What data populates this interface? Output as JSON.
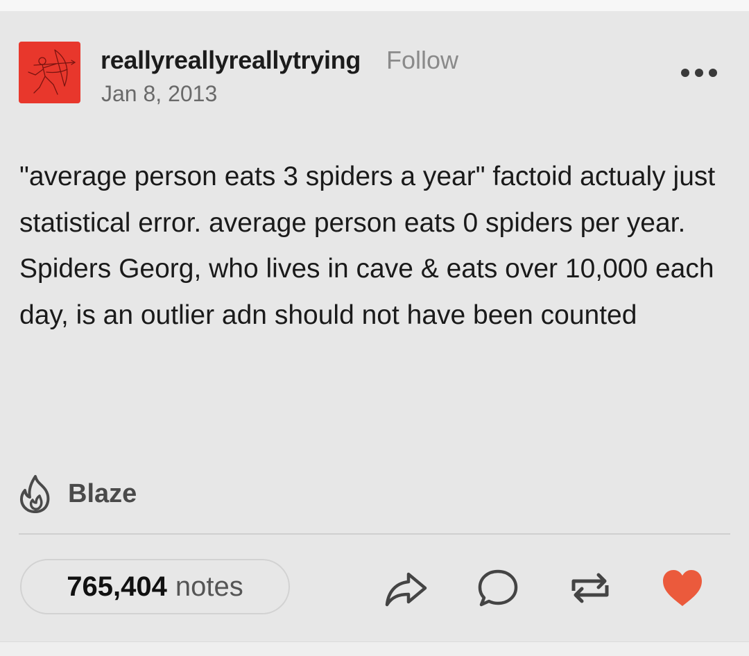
{
  "post": {
    "username": "reallyreallyreallytrying",
    "follow_label": "Follow",
    "date": "Jan 8, 2013",
    "body": "\"average person eats 3 spiders a year\" factoid actualy just statistical error. average person eats 0 spiders per year. Spiders Georg, who lives in cave & eats over 10,000 each day, is an outlier adn should not have been counted",
    "avatar_color": "#e8372c"
  },
  "blaze": {
    "label": "Blaze",
    "icon": "flame-icon"
  },
  "footer": {
    "notes_count": "765,404",
    "notes_label": "notes",
    "actions": [
      {
        "name": "share",
        "icon": "share-arrow-icon"
      },
      {
        "name": "reply",
        "icon": "speech-bubble-icon"
      },
      {
        "name": "reblog",
        "icon": "reblog-icon"
      },
      {
        "name": "like",
        "icon": "heart-icon",
        "liked": true,
        "color": "#eb5a3c"
      }
    ]
  }
}
